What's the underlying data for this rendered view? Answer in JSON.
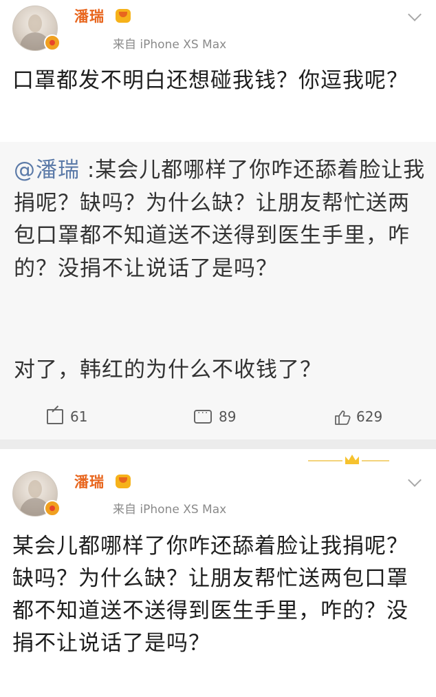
{
  "posts": [
    {
      "username": "潘瑞",
      "source": "来自 iPhone XS Max",
      "body": "口罩都发不明白还想碰我钱？你逗我呢？",
      "quote": {
        "mention": "@潘瑞",
        "text": " :某会儿都哪样了你咋还舔着脸让我捐呢？缺吗？为什么缺？让朋友帮忙送两包口罩都不知道送不送得到医生手里，咋的？没捐不让说话了是吗？",
        "text2": "对了，韩红的为什么不收钱了？"
      },
      "actions": {
        "repost_count": "61",
        "comment_count": "89",
        "like_count": "629"
      }
    },
    {
      "username": "潘瑞",
      "source": "来自 iPhone XS Max",
      "body": "某会儿都哪样了你咋还舔着脸让我捐呢？缺吗？为什么缺？让朋友帮忙送两包口罩都不知道送不送得到医生手里，咋的？没捐不让说话了是吗？"
    }
  ],
  "icons": {
    "verified": "verified-v-badge-icon",
    "vip": "vip-crown-icon",
    "menu": "chevron-down-icon",
    "repost": "repost-icon",
    "comment": "comment-icon",
    "like": "thumbs-up-icon"
  },
  "colors": {
    "username": "#e8661e",
    "mention": "#5b7aa8",
    "quote_background": "#f7f7f7"
  }
}
